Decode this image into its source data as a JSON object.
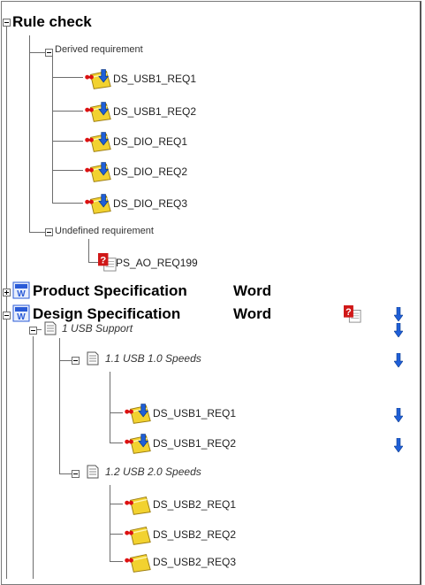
{
  "tree": {
    "rule_check": {
      "label": "Rule check",
      "derived": {
        "label": "Derived requirement",
        "items": [
          "DS_USB1_REQ1",
          "DS_USB1_REQ2",
          "DS_DIO_REQ1",
          "DS_DIO_REQ2",
          "DS_DIO_REQ3"
        ]
      },
      "undefined": {
        "label": "Undefined requirement",
        "items": [
          "PS_AO_REQ199"
        ]
      }
    },
    "product_spec": {
      "label": "Product Specification",
      "suffix": "Word"
    },
    "design_spec": {
      "label": "Design Specification",
      "suffix": "Word",
      "usb_support": {
        "label": "1 USB Support",
        "usb1": {
          "label": "1.1 USB 1.0 Speeds",
          "items": [
            "DS_USB1_REQ1",
            "DS_USB1_REQ2"
          ]
        },
        "usb2": {
          "label": "1.2 USB 2.0 Speeds",
          "items": [
            "DS_USB2_REQ1",
            "DS_USB2_REQ2",
            "DS_USB2_REQ3"
          ]
        }
      }
    }
  },
  "icons": {
    "requirement": "requirement-link-icon",
    "undefined": "undefined-requirement-icon",
    "word_doc": "word-document-icon",
    "section": "document-section-icon",
    "down_arrow": "down-arrow-icon"
  },
  "colors": {
    "arrow": "#1f5fd8",
    "undefined_badge": "#d01818",
    "word_blue": "#2a5bd7"
  }
}
